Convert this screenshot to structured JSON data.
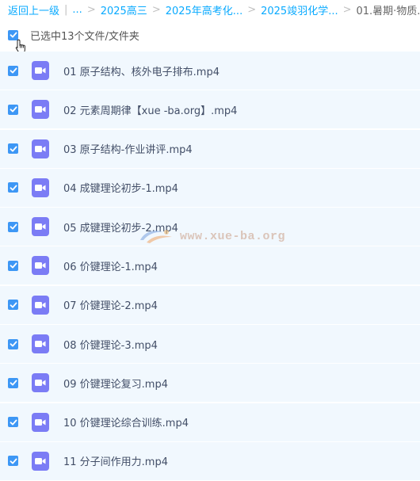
{
  "breadcrumb": {
    "back": "返回上一级",
    "divider": "|",
    "ellipsis": "...",
    "items": [
      "2025高三",
      "2025年高考化...",
      "2025竣羽化学...",
      "01.暑期·物质..."
    ]
  },
  "selection": {
    "label": "已选中13个文件/文件夹"
  },
  "files": [
    {
      "name": "01 原子结构、核外电子排布.mp4"
    },
    {
      "name": "02 元素周期律【xue -ba.org】.mp4"
    },
    {
      "name": "03 原子结构-作业讲评.mp4"
    },
    {
      "name": "04 成键理论初步-1.mp4"
    },
    {
      "name": "05 成键理论初步-2.mp4"
    },
    {
      "name": "06 价键理论-1.mp4"
    },
    {
      "name": "07 价键理论-2.mp4"
    },
    {
      "name": "08 价键理论-3.mp4"
    },
    {
      "name": "09 价键理论复习.mp4"
    },
    {
      "name": "10 价键理论综合训练.mp4"
    },
    {
      "name": "11 分子间作用力.mp4"
    }
  ],
  "watermark": {
    "text": "www.xue-ba.org"
  },
  "colors": {
    "accent": "#09aaff",
    "checkbox": "#3d97f5",
    "video_icon": "#7b7cf5",
    "row_bg": "#f1f8fe"
  },
  "icons": {
    "checkbox": "checkbox-checked-icon",
    "file": "video-file-icon",
    "cursor": "hand-pointer-icon"
  }
}
